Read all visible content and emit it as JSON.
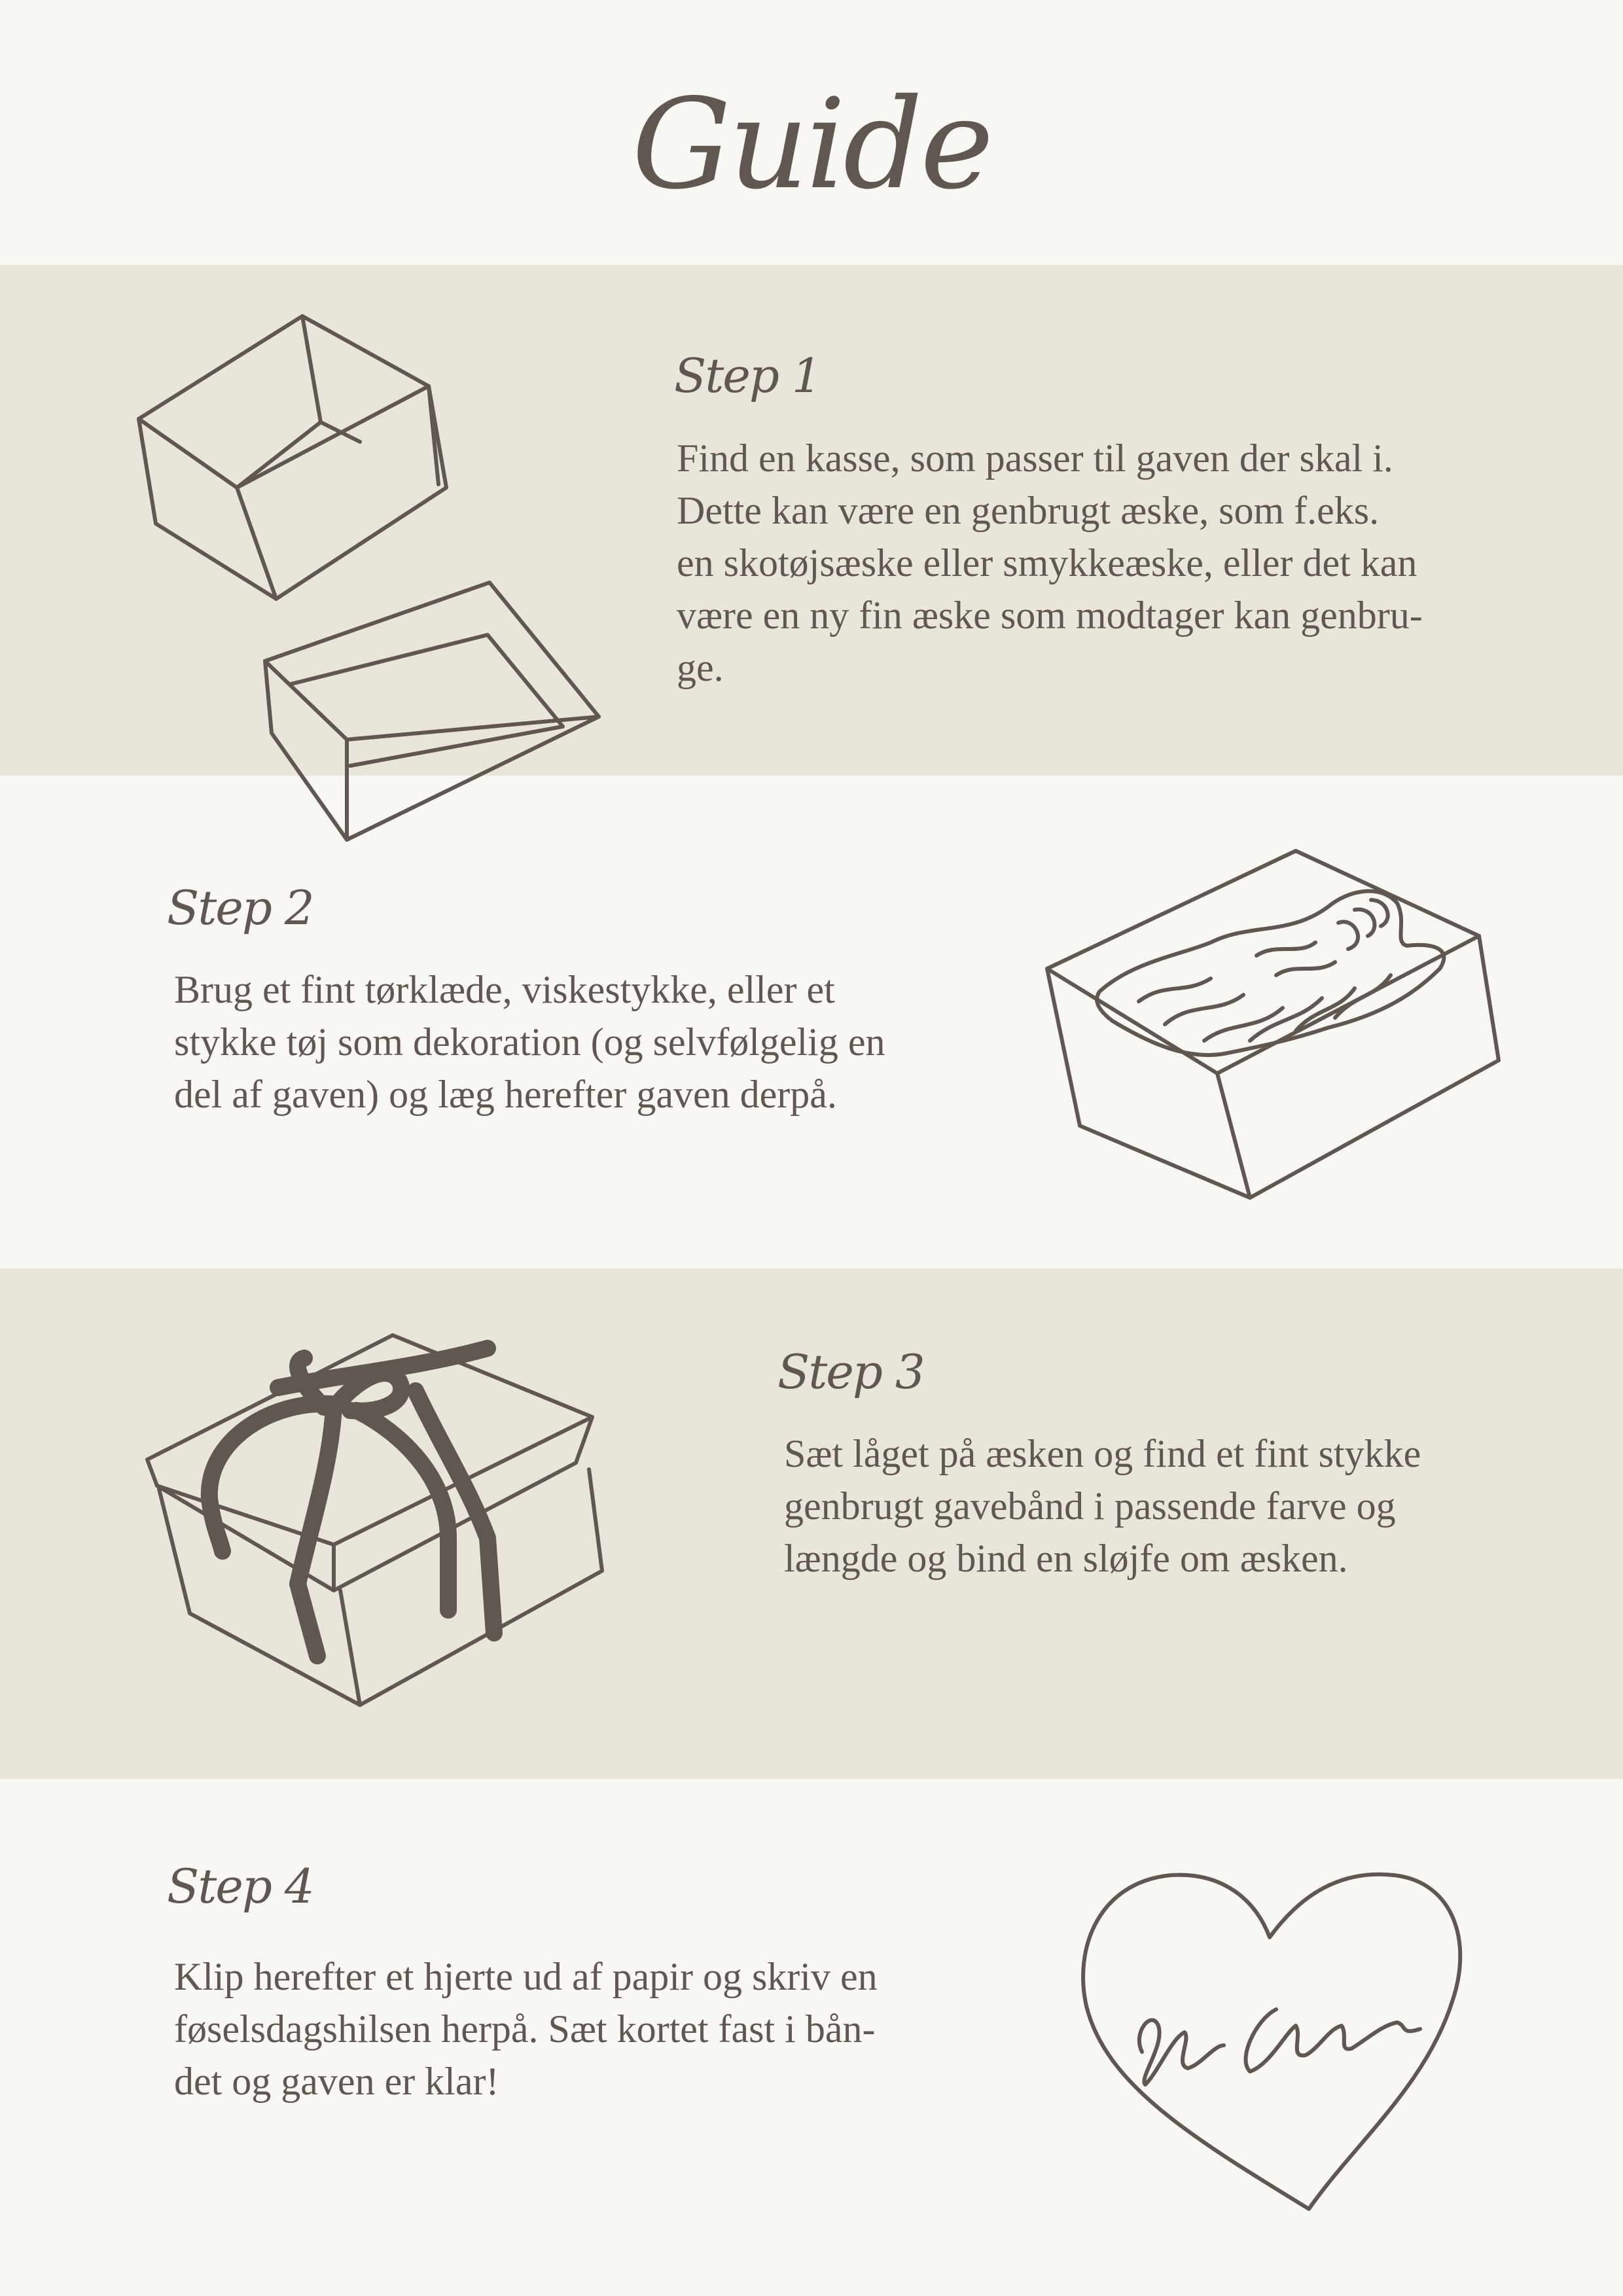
{
  "title": "Guide",
  "steps": [
    {
      "label": "Step 1",
      "lines": [
        "Find en kasse, som passer til gaven der skal i.",
        "Dette kan være en genbrugt æske, som f.eks.",
        "en skotøjsæske eller smykkeæske, eller det kan",
        "være en ny fin æske som modtager kan genbru-",
        "ge."
      ],
      "icon": "open-box-and-lid-icon"
    },
    {
      "label": "Step 2",
      "lines": [
        "Brug et fint tørklæde, viskestykke, eller et",
        "stykke tøj som dekoration (og selvfølgelig en",
        "del af gaven) og læg herefter gaven derpå."
      ],
      "icon": "box-with-fabric-icon"
    },
    {
      "label": "Step 3",
      "lines": [
        "Sæt låget på æsken og find et fint stykke",
        "genbrugt gavebånd i passende farve og",
        "længde og bind en sløjfe om æsken."
      ],
      "icon": "gift-box-with-ribbon-icon"
    },
    {
      "label": "Step 4",
      "lines": [
        "Klip herefter et hjerte ud af papir og skriv en",
        "føselsdagshilsen herpå. Sæt kortet fast i bån-",
        "det og gaven er klar!"
      ],
      "icon": "heart-card-icon"
    }
  ],
  "colors": {
    "background": "#f8f7f3",
    "band": "#e9e5db",
    "ink": "#5f5750"
  }
}
